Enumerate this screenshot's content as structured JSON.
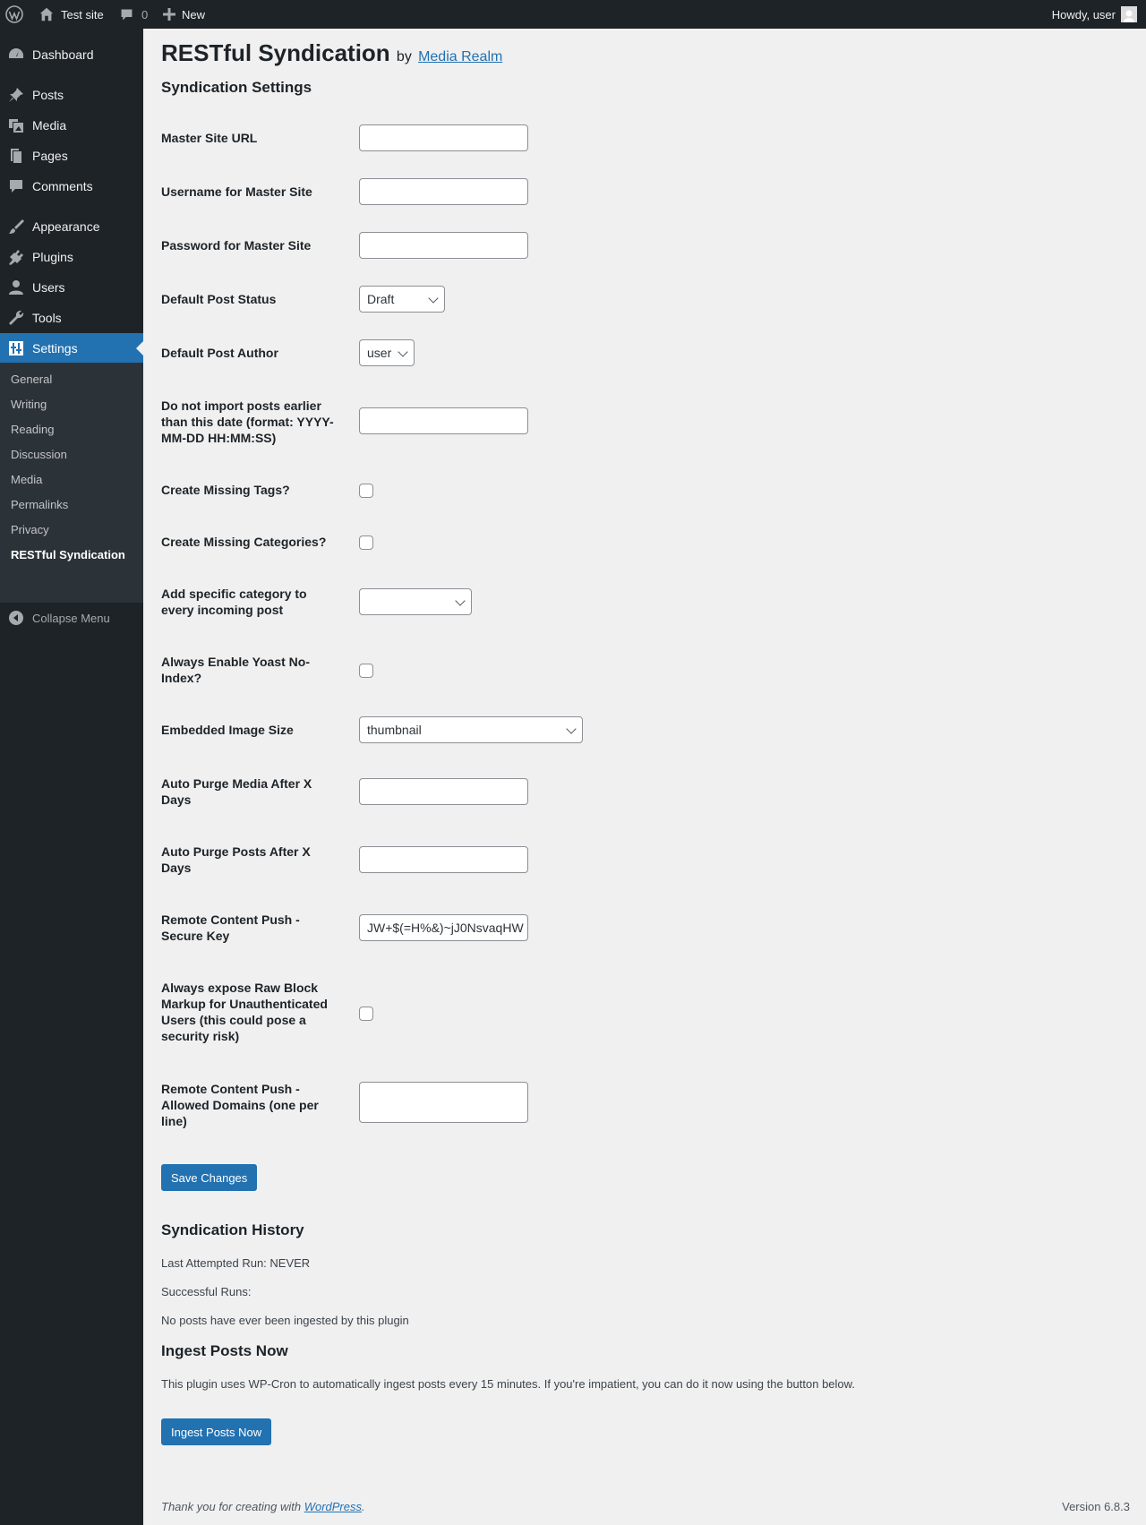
{
  "admin_bar": {
    "site_name": "Test site",
    "comments_count": "0",
    "new_label": "New",
    "howdy": "Howdy, user"
  },
  "sidebar": {
    "items": [
      {
        "label": "Dashboard",
        "icon": "dashboard-icon"
      },
      {
        "label": "Posts",
        "icon": "pushpin-icon"
      },
      {
        "label": "Media",
        "icon": "media-icon"
      },
      {
        "label": "Pages",
        "icon": "pages-icon"
      },
      {
        "label": "Comments",
        "icon": "comment-icon"
      },
      {
        "label": "Appearance",
        "icon": "paintbrush-icon"
      },
      {
        "label": "Plugins",
        "icon": "plugin-icon"
      },
      {
        "label": "Users",
        "icon": "user-icon"
      },
      {
        "label": "Tools",
        "icon": "wrench-icon"
      },
      {
        "label": "Settings",
        "icon": "settings-icon"
      }
    ],
    "submenu": [
      "General",
      "Writing",
      "Reading",
      "Discussion",
      "Media",
      "Permalinks",
      "Privacy",
      "RESTful Syndication"
    ],
    "collapse": "Collapse Menu"
  },
  "page": {
    "title": "RESTful Syndication",
    "by": "by",
    "author_link": "Media Realm",
    "settings_heading": "Syndication Settings"
  },
  "form": {
    "master_url": {
      "label": "Master Site URL",
      "value": ""
    },
    "username": {
      "label": "Username for Master Site",
      "value": ""
    },
    "password": {
      "label": "Password for Master Site",
      "value": ""
    },
    "post_status": {
      "label": "Default Post Status",
      "value": "Draft"
    },
    "post_author": {
      "label": "Default Post Author",
      "value": "user"
    },
    "earliest_date": {
      "label": "Do not import posts earlier than this date (format: YYYY-MM-DD HH:MM:SS)",
      "value": ""
    },
    "missing_tags": {
      "label": "Create Missing Tags?",
      "checked": false
    },
    "missing_categories": {
      "label": "Create Missing Categories?",
      "checked": false
    },
    "specific_category": {
      "label": "Add specific category to every incoming post",
      "value": ""
    },
    "yoast_noindex": {
      "label": "Always Enable Yoast No-Index?",
      "checked": false
    },
    "image_size": {
      "label": "Embedded Image Size",
      "value": "thumbnail"
    },
    "purge_media": {
      "label": "Auto Purge Media After X Days",
      "value": ""
    },
    "purge_posts": {
      "label": "Auto Purge Posts After X Days",
      "value": ""
    },
    "secure_key": {
      "label": "Remote Content Push - Secure Key",
      "value": "JW+$(=H%&)~jJ0NsvaqHW"
    },
    "raw_block": {
      "label": "Always expose Raw Block Markup for Unauthenticated Users (this could pose a security risk)",
      "checked": false
    },
    "allowed_domains": {
      "label": "Remote Content Push - Allowed Domains (one per line)",
      "value": ""
    },
    "save_label": "Save Changes"
  },
  "history": {
    "heading": "Syndication History",
    "last_run": "Last Attempted Run: NEVER",
    "successful_runs": "Successful Runs:",
    "none_ingested": "No posts have ever been ingested by this plugin"
  },
  "ingest": {
    "heading": "Ingest Posts Now",
    "description": "This plugin uses WP-Cron to automatically ingest posts every 15 minutes. If you're impatient, you can do it now using the button below.",
    "button_label": "Ingest Posts Now"
  },
  "footer": {
    "thanks_prefix": "Thank you for creating with ",
    "thanks_link": "WordPress",
    "thanks_suffix": ".",
    "version": "Version 6.8.3"
  }
}
